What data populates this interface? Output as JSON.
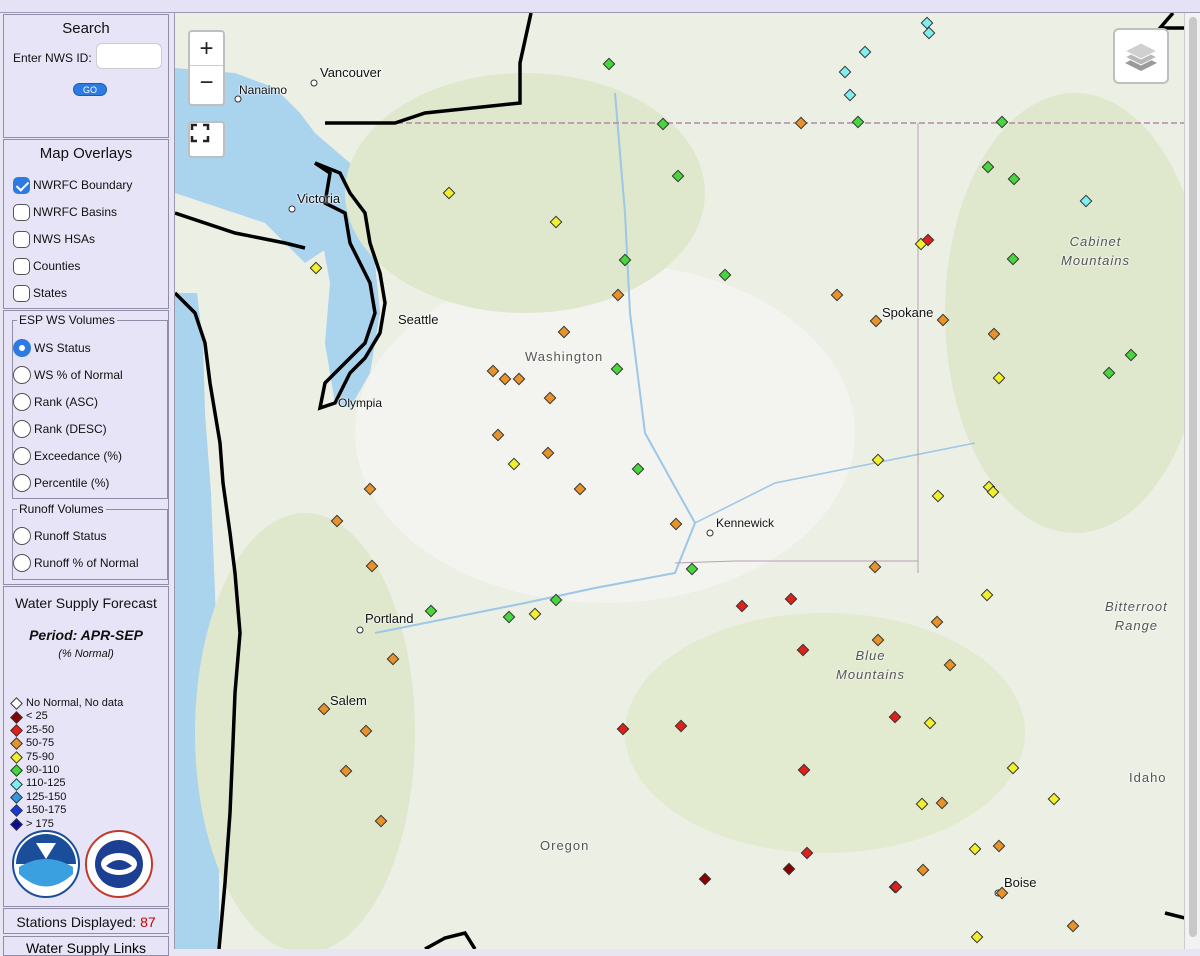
{
  "search": {
    "title": "Search",
    "label": "Enter NWS ID:",
    "placeholder": "",
    "go_label": "GO"
  },
  "overlays": {
    "title": "Map Overlays",
    "items": [
      {
        "label": "NWRFC Boundary",
        "checked": true
      },
      {
        "label": "NWRFC Basins",
        "checked": false
      },
      {
        "label": "NWS HSAs",
        "checked": false
      },
      {
        "label": "Counties",
        "checked": false
      },
      {
        "label": "States",
        "checked": false
      }
    ]
  },
  "esp": {
    "title": "ESP WS Volumes",
    "items": [
      {
        "label": "WS Status",
        "checked": true
      },
      {
        "label": "WS % of Normal",
        "checked": false
      },
      {
        "label": "Rank (ASC)",
        "checked": false
      },
      {
        "label": "Rank (DESC)",
        "checked": false
      },
      {
        "label": "Exceedance (%)",
        "checked": false
      },
      {
        "label": "Percentile (%)",
        "checked": false
      }
    ]
  },
  "runoff": {
    "title": "Runoff Volumes",
    "items": [
      {
        "label": "Runoff Status",
        "checked": false
      },
      {
        "label": "Runoff % of Normal",
        "checked": false
      }
    ]
  },
  "forecast": {
    "title": "Water Supply Forecast",
    "period": "Period: APR-SEP",
    "normal": "(% Normal)",
    "legend": [
      {
        "label": "No Normal, No data",
        "color": "#ffffff"
      },
      {
        "label": "< 25",
        "color": "#8b0000"
      },
      {
        "label": "25-50",
        "color": "#e0201b"
      },
      {
        "label": "50-75",
        "color": "#e8922a"
      },
      {
        "label": "75-90",
        "color": "#f2ef2c"
      },
      {
        "label": "90-110",
        "color": "#47d63e"
      },
      {
        "label": "110-125",
        "color": "#7ff0ef"
      },
      {
        "label": "125-150",
        "color": "#2f9be0"
      },
      {
        "label": "150-175",
        "color": "#1a3ad6"
      },
      {
        "label": "> 175",
        "color": "#0b0b8f"
      }
    ]
  },
  "stations": {
    "label": "Stations Displayed:",
    "count": "87"
  },
  "links": {
    "label": "Water Supply Links"
  },
  "map_controls": {
    "zoom_in": "+",
    "zoom_out": "−"
  },
  "map_labels": {
    "vancouver": "Vancouver",
    "nanaimo": "Nanaimo",
    "victoria": "Victoria",
    "seattle": "Seattle",
    "olympia": "Olympia",
    "washington": "Washington",
    "spokane": "Spokane",
    "kennewick": "Kennewick",
    "portland": "Portland",
    "salem": "Salem",
    "oregon": "Oregon",
    "boise": "Boise",
    "idaho": "Idaho",
    "cabinet": "Cabinet\nMountains",
    "bitterroot": "Bitterroot\nRange",
    "blue": "Blue\nMountains"
  },
  "station_categories": {
    "below_25": 3,
    "25_50": 10,
    "50_75": 37,
    "75_90": 19,
    "90_110": 18,
    "110_125": 5,
    "no_data": 0
  }
}
